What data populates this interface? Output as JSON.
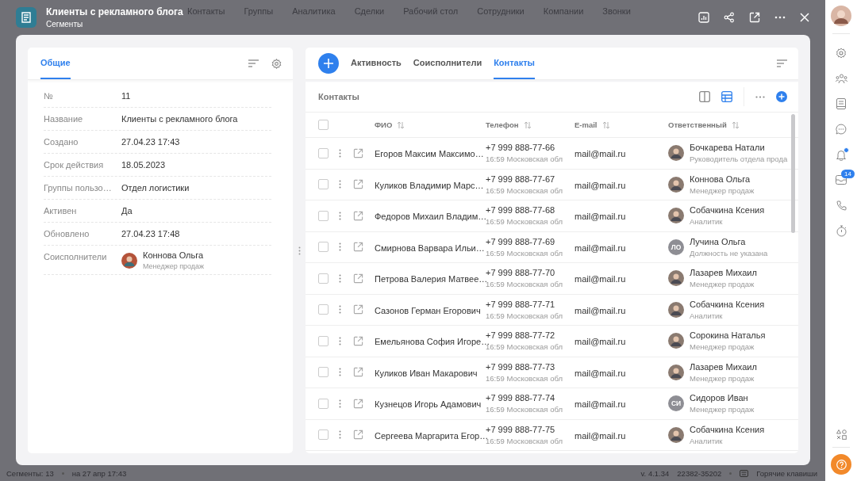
{
  "background": {
    "nav": [
      "Контакты",
      "Группы",
      "Аналитика",
      "Сделки",
      "Рабочий стол",
      "Сотрудники",
      "Компании",
      "Звонки"
    ]
  },
  "header": {
    "title": "Клиенты с рекламного блога",
    "subtitle": "Сегменты"
  },
  "left_panel": {
    "tabs": [
      {
        "label": "Общие",
        "selected": true
      }
    ],
    "fields": [
      {
        "kind": "text",
        "label": "№",
        "value": "11"
      },
      {
        "kind": "text",
        "label": "Название",
        "value": "Клиенты с рекламного блога"
      },
      {
        "kind": "text",
        "label": "Создано",
        "value": "27.04.23 17:43"
      },
      {
        "kind": "text",
        "label": "Срок действия",
        "value": "18.05.2023"
      },
      {
        "kind": "text",
        "label": "Группы пользо…",
        "value": "Отдел логистики"
      },
      {
        "kind": "text",
        "label": "Активен",
        "value": "Да"
      },
      {
        "kind": "text",
        "label": "Обновлено",
        "value": "27.04.23 17:48"
      },
      {
        "kind": "person",
        "label": "Соисполнители",
        "person": {
          "name": "Коннова Ольга",
          "role": "Менеджер продаж"
        }
      }
    ]
  },
  "right_panel": {
    "tabs": [
      {
        "label": "Активность",
        "selected": false
      },
      {
        "label": "Соисполнители",
        "selected": false
      },
      {
        "label": "Контакты",
        "selected": true
      }
    ],
    "section_title": "Контакты",
    "view_modes": [
      {
        "kind": "columns",
        "selected": false
      },
      {
        "kind": "table",
        "selected": true
      }
    ],
    "table": {
      "all_checked": false,
      "columns": [
        "ФИО",
        "Телефон",
        "E-mail",
        "Ответственный"
      ],
      "rows": [
        {
          "checked": false,
          "name": "Егоров Максим Максимо…",
          "phone": "+7 999 888-77-66",
          "region": "16:59 Московская обл",
          "email": "mail@mail.ru",
          "responsible": {
            "name": "Бочкарева Натали",
            "role": "Руководитель отдела прода"
          }
        },
        {
          "checked": false,
          "name": "Куликов Владимир Марс…",
          "phone": "+7 999 888-77-67",
          "region": "16:59 Московская обл",
          "email": "mail@mail.ru",
          "responsible": {
            "name": "Коннова Ольга",
            "role": "Менеджер продаж"
          }
        },
        {
          "checked": false,
          "name": "Федоров Михаил Владим…",
          "phone": "+7 999 888-77-68",
          "region": "16:59 Московская обл",
          "email": "mail@mail.ru",
          "responsible": {
            "name": "Собачкина Ксения",
            "role": "Аналитик"
          }
        },
        {
          "checked": false,
          "name": "Смирнова Варвара Ильи…",
          "phone": "+7 999 888-77-69",
          "region": "16:59 Московская обл",
          "email": "mail@mail.ru",
          "responsible": {
            "name": "Лучина Ольга",
            "role": "Должность не указана",
            "initials": "ЛО"
          }
        },
        {
          "checked": false,
          "name": "Петрова Валерия Матвее…",
          "phone": "+7 999 888-77-70",
          "region": "16:59 Московская обл",
          "email": "mail@mail.ru",
          "responsible": {
            "name": "Лазарев Михаил",
            "role": "Менеджер продаж"
          }
        },
        {
          "checked": false,
          "name": "Сазонов Герман Егорович",
          "phone": "+7 999 888-77-71",
          "region": "16:59 Московская обл",
          "email": "mail@mail.ru",
          "responsible": {
            "name": "Собачкина Ксения",
            "role": "Аналитик"
          }
        },
        {
          "checked": false,
          "name": "Емельянова София Игоре…",
          "phone": "+7 999 888-77-72",
          "region": "16:59 Московская обл",
          "email": "mail@mail.ru",
          "responsible": {
            "name": "Сорокина Наталья",
            "role": "Менеджер продаж"
          }
        },
        {
          "checked": false,
          "name": "Куликов Иван Макарович",
          "phone": "+7 999 888-77-73",
          "region": "16:59 Московская обл",
          "email": "mail@mail.ru",
          "responsible": {
            "name": "Лазарев Михаил",
            "role": "Менеджер продаж"
          }
        },
        {
          "checked": false,
          "name": "Кузнецов Игорь Адамович",
          "phone": "+7 999 888-77-74",
          "region": "16:59 Московская обл",
          "email": "mail@mail.ru",
          "responsible": {
            "name": "Сидоров Иван",
            "role": "Менеджер продаж",
            "initials": "СИ"
          }
        },
        {
          "checked": false,
          "name": "Сергеева Маргарита Егор…",
          "phone": "+7 999 888-77-75",
          "region": "16:59 Московская обл",
          "email": "mail@mail.ru",
          "responsible": {
            "name": "Собачкина Ксения",
            "role": "Аналитик"
          }
        }
      ]
    }
  },
  "right_sidebar": {
    "items": [
      {
        "kind": "gear",
        "dot": false
      },
      {
        "kind": "people",
        "dot": false
      },
      {
        "kind": "book",
        "dot": false
      },
      {
        "kind": "chat",
        "dot": false
      },
      {
        "kind": "bell",
        "dot": true
      },
      {
        "kind": "mail",
        "dot": false,
        "badge": "14"
      },
      {
        "kind": "phone",
        "dot": false
      },
      {
        "kind": "timer",
        "dot": false
      }
    ]
  },
  "status_bar": {
    "segments": "Сегменты: 13",
    "updated": "на 27 апр 17:43",
    "version": "v. 4.1.34",
    "build": "22382-35202",
    "hotkeys": "Горячие клавиши"
  }
}
